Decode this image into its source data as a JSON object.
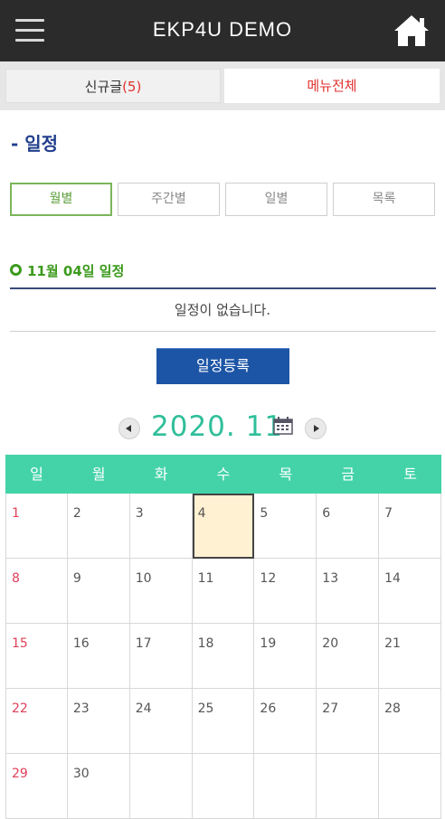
{
  "header": {
    "title": "EKP4U DEMO",
    "menu_icon": "hamburger-menu-icon",
    "home_icon": "home-icon"
  },
  "tabs": [
    {
      "label": "신규글",
      "count": "(5)"
    },
    {
      "label": "메뉴전체"
    }
  ],
  "section": {
    "title": "- 일정"
  },
  "view_buttons": [
    "월별",
    "주간별",
    "일별",
    "목록"
  ],
  "active_view": "월별",
  "day_schedule": {
    "title": "11월 04일 일정",
    "empty_message": "일정이 없습니다."
  },
  "register_button": "일정등록",
  "month_nav": {
    "label": "2020. 11",
    "prev_icon": "chevron-left-icon",
    "next_icon": "chevron-right-icon",
    "calendar_icon": "calendar-icon"
  },
  "calendar": {
    "weekdays": [
      "일",
      "월",
      "화",
      "수",
      "목",
      "금",
      "토"
    ],
    "today": "4",
    "weeks": [
      [
        "1",
        "2",
        "3",
        "4",
        "5",
        "6",
        "7"
      ],
      [
        "8",
        "9",
        "10",
        "11",
        "12",
        "13",
        "14"
      ],
      [
        "15",
        "16",
        "17",
        "18",
        "19",
        "20",
        "21"
      ],
      [
        "22",
        "23",
        "24",
        "25",
        "26",
        "27",
        "28"
      ],
      [
        "29",
        "30",
        "",
        "",
        "",
        "",
        ""
      ]
    ]
  },
  "colors": {
    "header_bg": "#2b2b2b",
    "accent_red": "#e0312f",
    "title_blue": "#213f8c",
    "green": "#3c9a1d",
    "teal": "#44d3a8",
    "button_blue": "#1d55a6",
    "today_bg": "#fff1d2"
  }
}
